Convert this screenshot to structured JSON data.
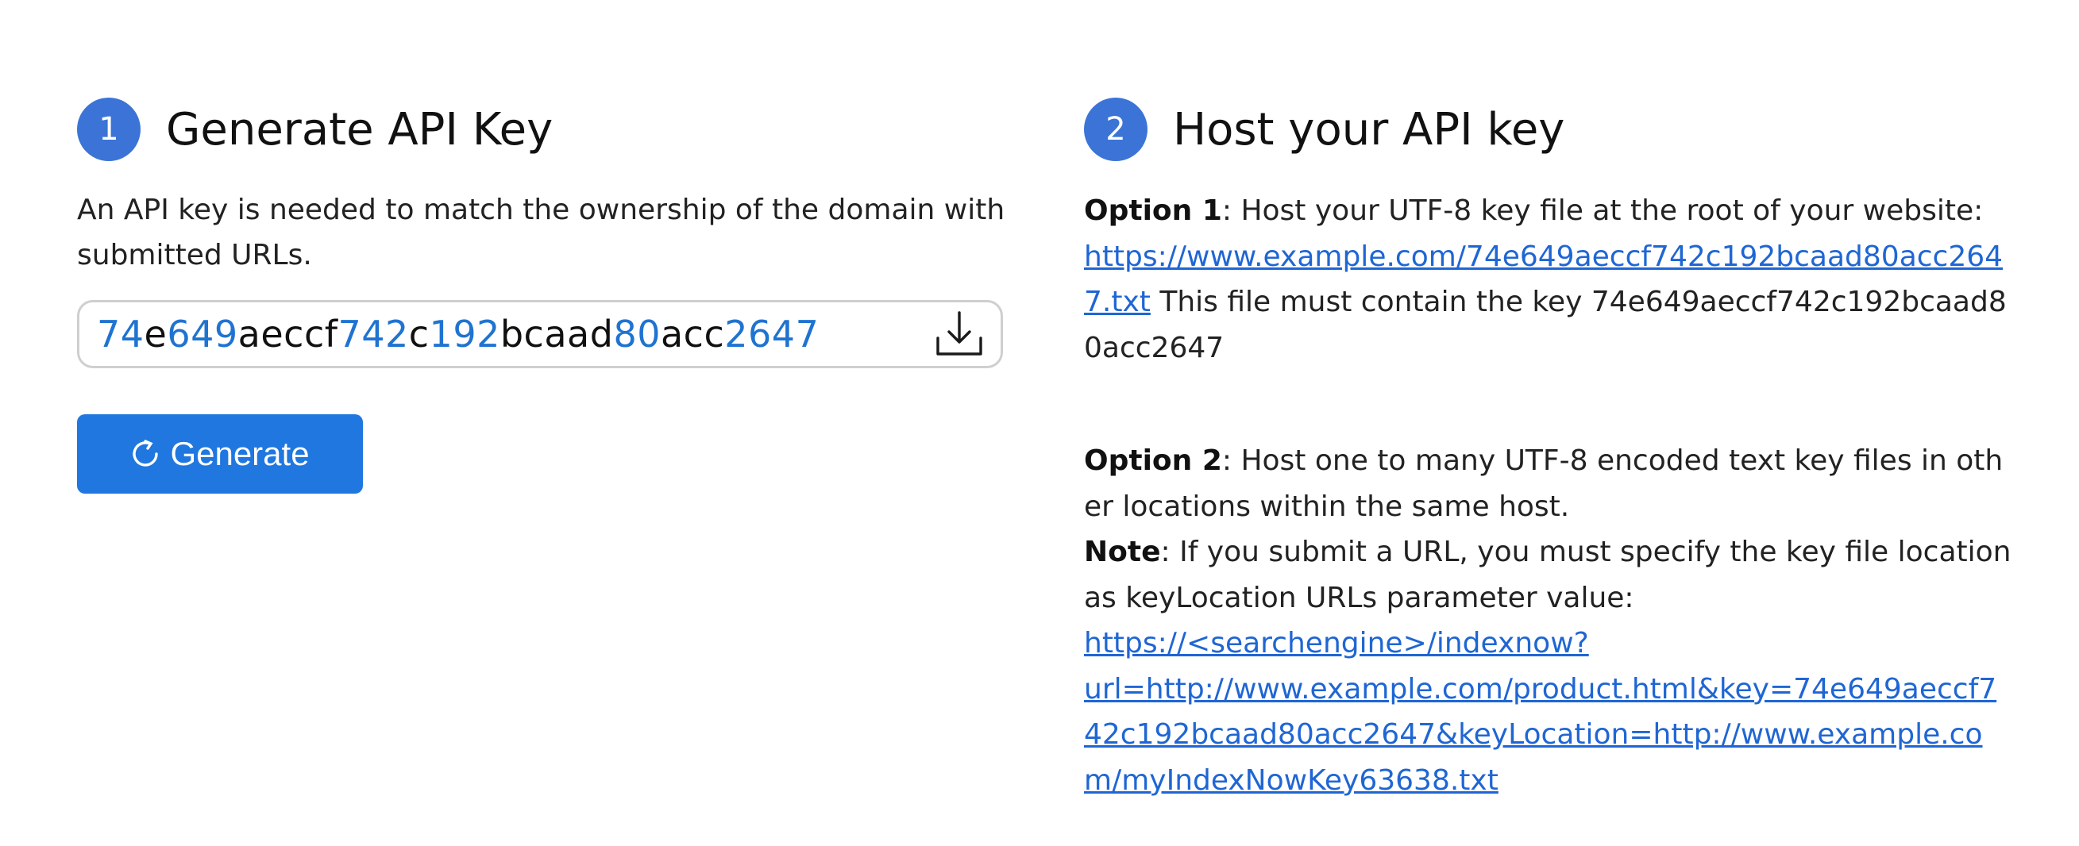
{
  "step1": {
    "number": "1",
    "title": "Generate API Key",
    "description": "An API key is needed to match the ownership of the domain with submitted URLs.",
    "key_segments": [
      {
        "text": "74",
        "digit": true
      },
      {
        "text": "e",
        "digit": false
      },
      {
        "text": "649",
        "digit": true
      },
      {
        "text": "aeccf",
        "digit": false
      },
      {
        "text": "742",
        "digit": true
      },
      {
        "text": "c",
        "digit": false
      },
      {
        "text": "192",
        "digit": true
      },
      {
        "text": "bcaad",
        "digit": false
      },
      {
        "text": "80",
        "digit": true
      },
      {
        "text": "acc",
        "digit": false
      },
      {
        "text": "2647",
        "digit": true
      }
    ],
    "download_icon": "download-icon",
    "generate_label": "Generate",
    "generate_icon": "refresh-icon"
  },
  "step2": {
    "number": "2",
    "title": "Host your API key",
    "option1_label": "Option 1",
    "option1_text": ": Host your UTF-8 key file at the root of your website:",
    "option1_link": "https://www.example.com/74e649aeccf742c192bcaad80acc2647.txt",
    "option1_after": " This file must contain the key 74e649aeccf742c192bcaad80acc2647",
    "option2_label": "Option 2",
    "option2_text": ": Host one to many UTF-8 encoded text key files in other locations within the same host.",
    "note_label": "Note",
    "note_text": ": If you submit a URL, you must specify the key file location as keyLocation URLs parameter value:",
    "note_link_line1": "https://<searchengine>/indexnow?",
    "note_link_rest": "url=http://www.example.com/product.html&key=74e649aeccf742c192bcaad80acc2647&keyLocation=http://www.example.com/myIndexNowKey63638.txt"
  },
  "colors": {
    "step_circle": "#3b74d6",
    "key_digit": "#1f73d1",
    "button": "#1f77df",
    "link": "#1f66d4"
  }
}
